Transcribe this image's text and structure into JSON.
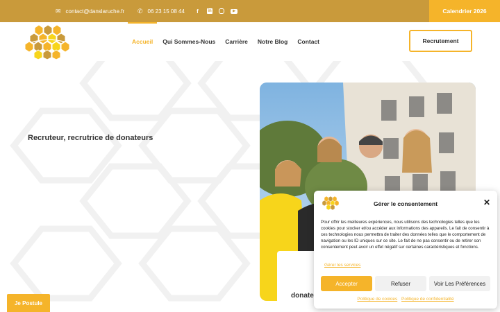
{
  "topbar": {
    "email": "contact@danslaruche.fr",
    "phone": "06 23 15 08 44",
    "email_icon": "envelope-icon",
    "phone_icon": "phone-icon",
    "socials": [
      {
        "name": "facebook-icon",
        "glyph": "f"
      },
      {
        "name": "linkedin-icon",
        "glyph": "in"
      },
      {
        "name": "instagram-icon",
        "glyph": ""
      },
      {
        "name": "youtube-icon",
        "glyph": "▶"
      }
    ],
    "calendar_label": "Calendrier 2026"
  },
  "header": {
    "nav": [
      {
        "label": "Accueil",
        "active": true
      },
      {
        "label": "Qui Sommes-Nous",
        "active": false
      },
      {
        "label": "Carrière",
        "active": false
      },
      {
        "label": "Notre Blog",
        "active": false
      },
      {
        "label": "Contact",
        "active": false
      }
    ],
    "recruit_label": "Recrutement"
  },
  "hero": {
    "title": "Recruteur, recrutrice de donateurs",
    "card_text": "donate"
  },
  "postule_label": "Je Postule",
  "consent": {
    "title": "Gérer le consentement",
    "text": "Pour offrir les meilleures expériences, nous utilisons des technologies telles que les cookies pour stocker et/ou accéder aux informations des appareils. Le fait de consentir à ces technologies nous permettra de traiter des données telles que le comportement de navigation ou les ID uniques sur ce site. Le fait de ne pas consentir ou de retirer son consentement peut avoir un effet négatif sur certaines caractéristiques et fonctions.",
    "manage_label": "Gérer les services",
    "accept_label": "Accepter",
    "refuse_label": "Refuser",
    "prefs_label": "Voir Les Préférences",
    "cookie_policy": "Politique de cookies",
    "privacy_policy": "Politique de confidentialité"
  },
  "colors": {
    "topbar": "#c99a3b",
    "accent": "#f5b42a",
    "shirt_yellow": "#f7d51b"
  }
}
